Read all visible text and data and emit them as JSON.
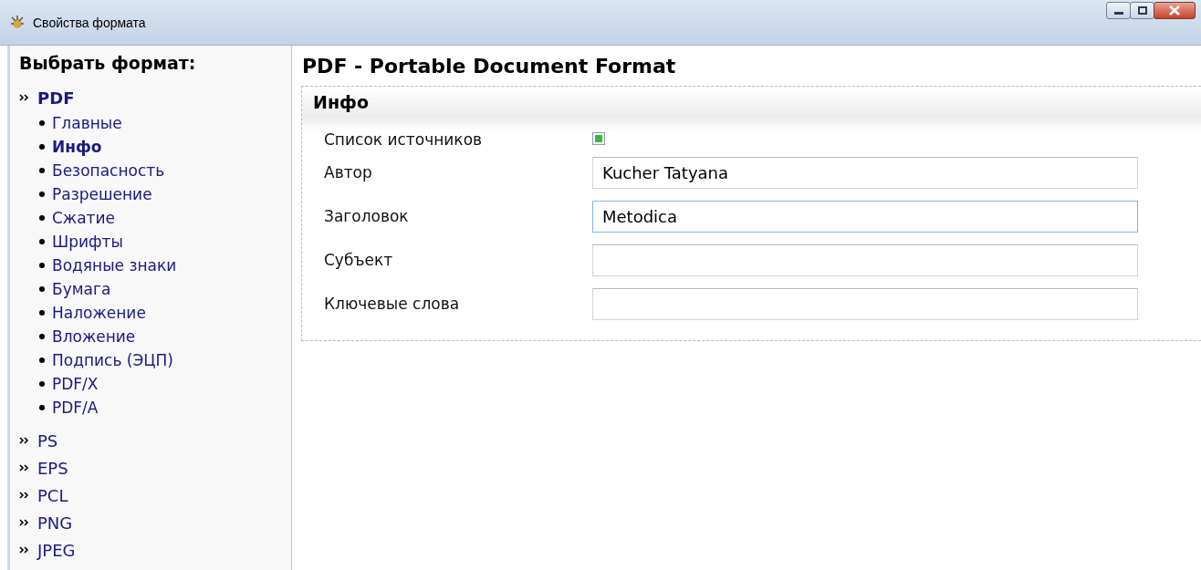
{
  "window": {
    "title": "Свойства формата"
  },
  "sidebar": {
    "title": "Выбрать формат:",
    "formats": [
      {
        "label": "PDF",
        "selected": true,
        "children": [
          {
            "label": "Главные",
            "selected": false
          },
          {
            "label": "Инфо",
            "selected": true
          },
          {
            "label": "Безопасность",
            "selected": false
          },
          {
            "label": "Разрешение",
            "selected": false
          },
          {
            "label": "Сжатие",
            "selected": false
          },
          {
            "label": "Шрифты",
            "selected": false
          },
          {
            "label": "Водяные знаки",
            "selected": false
          },
          {
            "label": "Бумага",
            "selected": false
          },
          {
            "label": "Наложение",
            "selected": false
          },
          {
            "label": "Вложение",
            "selected": false
          },
          {
            "label": "Подпись (ЭЦП)",
            "selected": false
          },
          {
            "label": "PDF/X",
            "selected": false
          },
          {
            "label": "PDF/A",
            "selected": false
          }
        ]
      },
      {
        "label": "PS",
        "selected": false
      },
      {
        "label": "EPS",
        "selected": false
      },
      {
        "label": "PCL",
        "selected": false
      },
      {
        "label": "PNG",
        "selected": false
      },
      {
        "label": "JPEG",
        "selected": false
      }
    ]
  },
  "main": {
    "title": "PDF - Portable Document Format",
    "section": {
      "title": "Инфо",
      "fields": [
        {
          "kind": "checkbox",
          "label": "Список источников",
          "checked": true
        },
        {
          "kind": "text",
          "label": "Автор",
          "value": "Kucher Tatyana",
          "focused": false
        },
        {
          "kind": "text",
          "label": "Заголовок",
          "value": "Metodica",
          "focused": true
        },
        {
          "kind": "text",
          "label": "Субъект",
          "focused": false
        },
        {
          "kind": "text",
          "label": "Ключевые слова",
          "focused": false
        }
      ]
    }
  }
}
